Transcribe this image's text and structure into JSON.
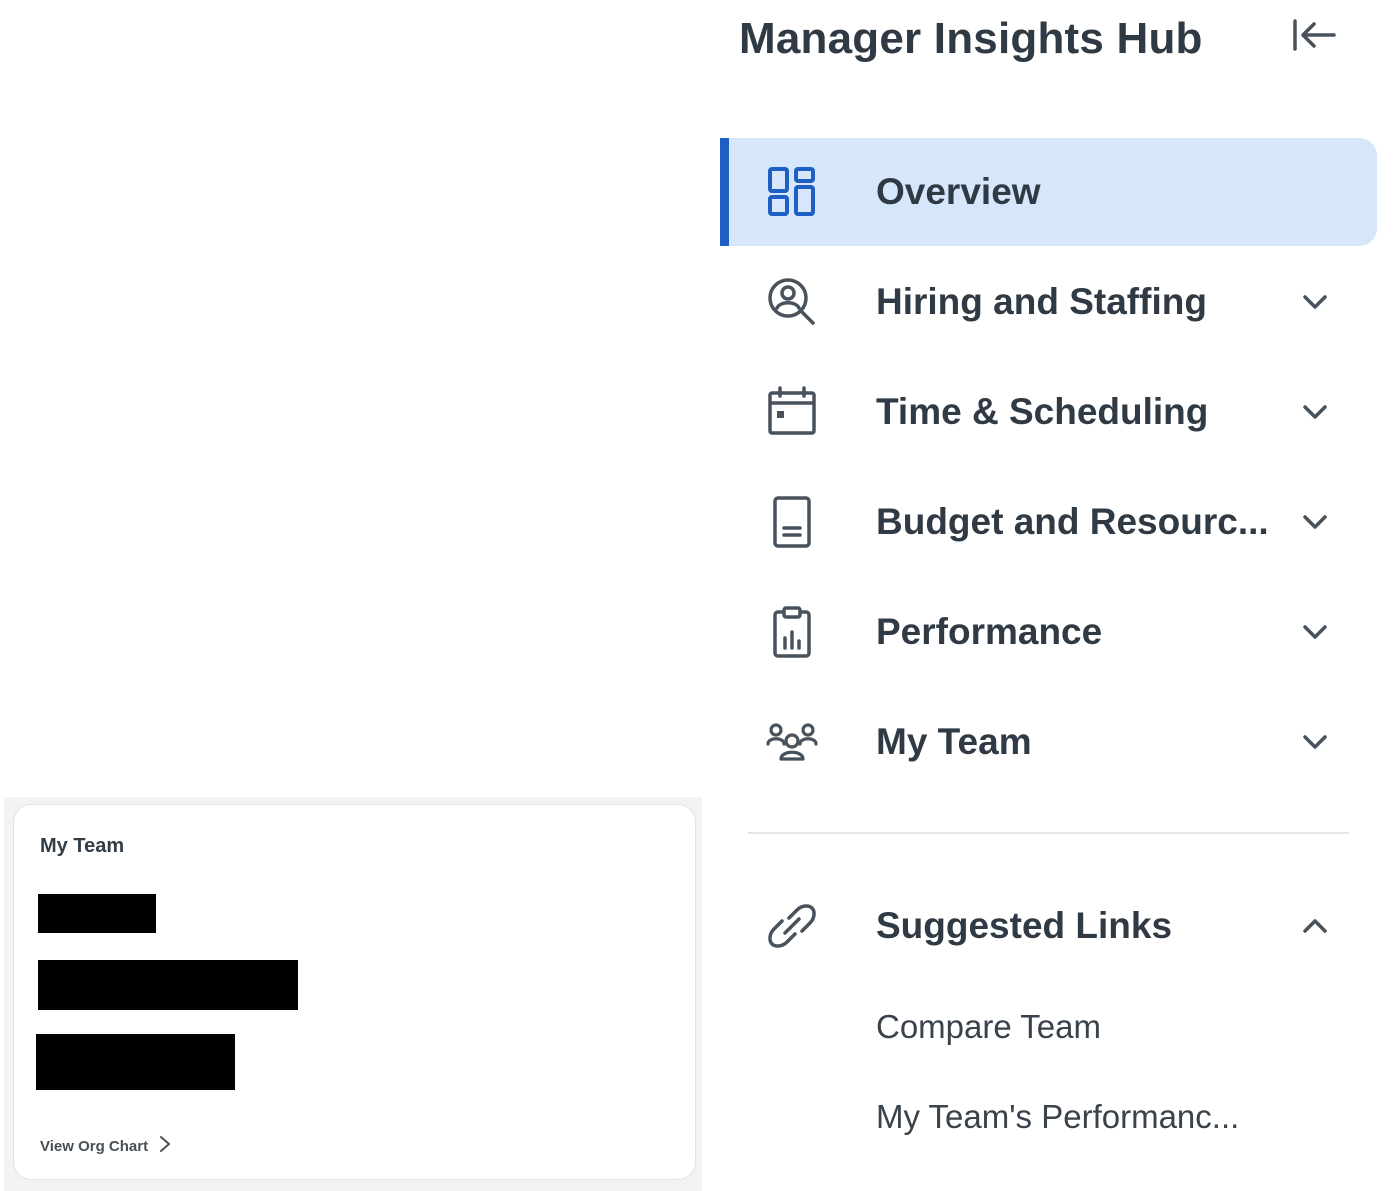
{
  "colors": {
    "accent": "#1e5fc4",
    "active_bg": "#d6e6fb",
    "text": "#2f3a45",
    "icon_blue": "#1e5fc4",
    "icon_gray": "#48525c"
  },
  "team_card": {
    "title": "My Team",
    "redacted_rows": 3,
    "view_org_chart_label": "View Org Chart",
    "view_org_chart_icon": "chevron-right-icon"
  },
  "nav": {
    "title": "Manager Insights Hub",
    "collapse_icon": "collapse-left-icon",
    "items": [
      {
        "label": "Overview",
        "icon": "dashboard-icon",
        "active": true,
        "expandable": false
      },
      {
        "label": "Hiring and Staffing",
        "icon": "person-search-icon",
        "active": false,
        "expandable": true,
        "expanded": false
      },
      {
        "label": "Time & Scheduling",
        "icon": "calendar-icon",
        "active": false,
        "expandable": true,
        "expanded": false
      },
      {
        "label": "Budget and Resourc...",
        "icon": "document-icon",
        "active": false,
        "expandable": true,
        "expanded": false
      },
      {
        "label": "Performance",
        "icon": "clipboard-chart-icon",
        "active": false,
        "expandable": true,
        "expanded": false
      },
      {
        "label": "My Team",
        "icon": "team-icon",
        "active": false,
        "expandable": true,
        "expanded": false
      }
    ],
    "suggested_links": {
      "label": "Suggested Links",
      "icon": "link-icon",
      "expanded": true,
      "links": [
        {
          "label": "Compare Team"
        },
        {
          "label": "My Team's Performanc..."
        }
      ]
    }
  }
}
